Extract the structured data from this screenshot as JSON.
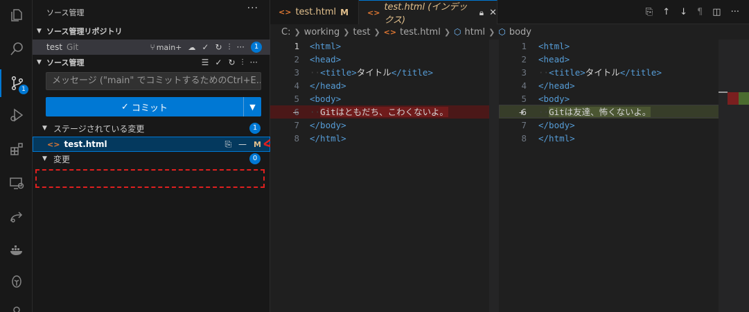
{
  "activity": {
    "scm_badge": "1",
    "colors": {
      "accent": "#0078d4"
    }
  },
  "sidebar": {
    "title": "ソース管理",
    "more": "···",
    "repos_header": "ソース管理リポジトリ",
    "repo": {
      "name": "test",
      "kind": "Git",
      "branch": "main+",
      "badge": "1"
    },
    "scm_header": "ソース管理",
    "message_placeholder": "メッセージ (\"main\" でコミットするためのCtrl+E...",
    "commit_label": "コミット",
    "staged_label": "ステージされている変更",
    "staged_count": "1",
    "staged_file": {
      "name": "test.html",
      "status": "M"
    },
    "changes_label": "変更",
    "changes_count": "0"
  },
  "editor": {
    "tab1": {
      "label": "test.html",
      "mod": "M"
    },
    "tab2": {
      "label": "test.html (インデックス)"
    },
    "breadcrumb": {
      "drive": "C:",
      "folder1": "working",
      "folder2": "test",
      "file": "test.html",
      "el1": "html",
      "el2": "body"
    },
    "left_lines": [
      {
        "n": "1",
        "code": "<html>"
      },
      {
        "n": "2",
        "code": "<head>"
      },
      {
        "n": "3",
        "code": "<title>タイトル</title>"
      },
      {
        "n": "4",
        "code": "</head>"
      },
      {
        "n": "5",
        "code": "<body>"
      },
      {
        "n": "6",
        "text": "Gitはともだち、こわくないよ。",
        "marker": "—"
      },
      {
        "n": "7",
        "code": "</body>"
      },
      {
        "n": "8",
        "code": "</html>"
      }
    ],
    "right_lines": [
      {
        "n": "1",
        "code": "<html>"
      },
      {
        "n": "2",
        "code": "<head>"
      },
      {
        "n": "3",
        "code": "<title>タイトル</title>"
      },
      {
        "n": "4",
        "code": "</head>"
      },
      {
        "n": "5",
        "code": "<body>"
      },
      {
        "n": "6",
        "text": "Gitは友達、怖くないよ。",
        "marker": "+"
      },
      {
        "n": "7",
        "code": "</body>"
      },
      {
        "n": "8",
        "code": "</html>"
      }
    ]
  }
}
